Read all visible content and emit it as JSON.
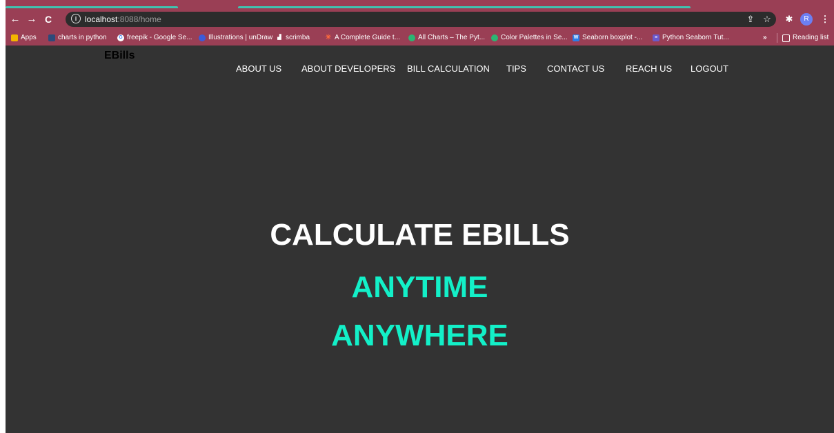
{
  "browser": {
    "url_host": "localhost",
    "url_path": ":8088/home",
    "info_icon": "i",
    "profile_initial": "R",
    "bookmarks": [
      {
        "label": "Apps",
        "icon_color": "#f4b400"
      },
      {
        "label": "charts in python",
        "icon_color": "#2d4a7a"
      },
      {
        "label": "freepik - Google Se...",
        "icon_color": "#ffffff"
      },
      {
        "label": "Illustrations | unDraw",
        "icon_color": "#3b5bdb"
      },
      {
        "label": "scrimba",
        "icon_color": "#f5f5f5"
      },
      {
        "label": "A Complete Guide t...",
        "icon_color": "#ff6b3d"
      },
      {
        "label": "All Charts – The Pyt...",
        "icon_color": "#2bb673"
      },
      {
        "label": "Color Palettes in Se...",
        "icon_color": "#2bb673"
      },
      {
        "label": "Seaborn boxplot -...",
        "icon_color": "#2b7de9"
      },
      {
        "label": "Python Seaborn Tut...",
        "icon_color": "#6a5acd"
      }
    ],
    "overflow": "»",
    "reading_list": "Reading list"
  },
  "site": {
    "brand": "EBills",
    "nav": [
      "ABOUT US",
      "ABOUT DEVELOPERS",
      "BILL CALCULATION",
      "TIPS",
      "CONTACT US",
      "REACH US",
      "LOGOUT"
    ]
  },
  "hero": {
    "line1": "CALCULATE EBILLS",
    "line2": "ANYTIME",
    "line3": "ANYWHERE"
  },
  "colors": {
    "browser_chrome": "#9a3f55",
    "page_background": "#333333",
    "accent": "#13f0c8"
  }
}
